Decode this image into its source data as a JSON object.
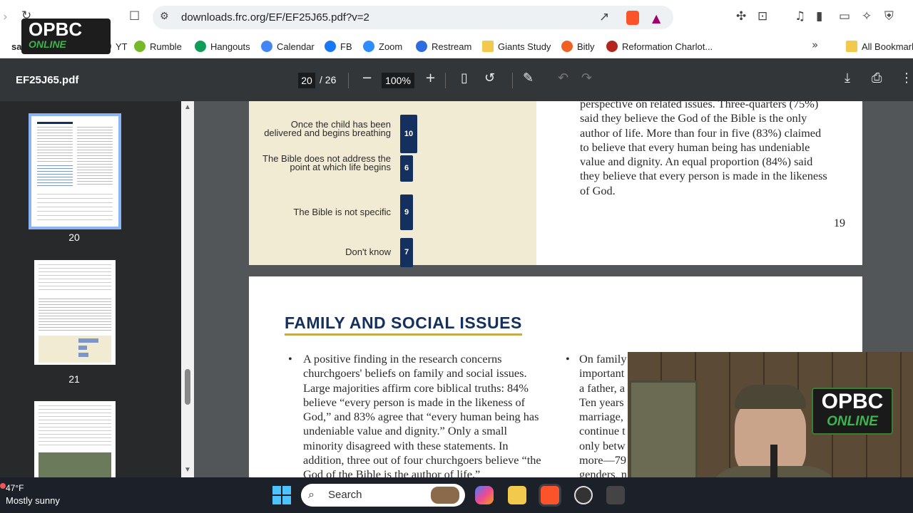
{
  "browser": {
    "url": "downloads.frc.org/EF/EF25J65.pdf?v=2",
    "overlay_logo_top": "OPBC",
    "overlay_logo_bottom": "ONLINE"
  },
  "bookmarks": [
    {
      "label": "YT",
      "icon": "youtube-icon",
      "color": "#e11"
    },
    {
      "label": "Rumble",
      "icon": "rumble-icon",
      "color": "#76b82a"
    },
    {
      "label": "Hangouts",
      "icon": "hangouts-icon",
      "color": "#0f9d58"
    },
    {
      "label": "Calendar",
      "icon": "calendar-icon",
      "color": "#4285f4"
    },
    {
      "label": "FB",
      "icon": "facebook-icon",
      "color": "#1877f2"
    },
    {
      "label": "Zoom",
      "icon": "zoom-icon",
      "color": "#2d8cff"
    },
    {
      "label": "Restream",
      "icon": "restream-icon",
      "color": "#2d6cdf"
    },
    {
      "label": "Giants Study",
      "icon": "folder-icon",
      "color": "#f2c94c"
    },
    {
      "label": "Bitly",
      "icon": "bitly-icon",
      "color": "#ee6123"
    },
    {
      "label": "Reformation Charlot...",
      "icon": "reformation-icon",
      "color": "#b3261e"
    },
    {
      "label": "All Bookmarks",
      "icon": "folder-icon",
      "color": "#f2c94c"
    }
  ],
  "pdf": {
    "filename": "EF25J65.pdf",
    "current_page": "20",
    "total_pages": "/ 26",
    "zoom": "100%",
    "thumbnails": [
      {
        "num": "20"
      },
      {
        "num": "21"
      }
    ]
  },
  "page19": {
    "bars": [
      {
        "label": "Once the child has been delivered and begins breathing",
        "value": 10
      },
      {
        "label": "The Bible does not address the point at which life begins",
        "value": 6
      },
      {
        "label": "The Bible is not specific",
        "value": 9
      },
      {
        "label": "Don't know",
        "value": 7
      }
    ],
    "text": "perspective on related issues. Three-quarters (75%) said they believe the God of the Bible is the only author of life. More than four in five (83%) claimed to believe that every human being has undeniable value and dignity. An equal proportion (84%) said they believe that every person is made in the likeness of God.",
    "page_number": "19"
  },
  "page20": {
    "section_title": "FAMILY AND SOCIAL ISSUES",
    "left_bullet": "A positive finding in the research concerns churchgoers' beliefs on family and social issues. Large majorities affirm core biblical truths: 84% believe “every person is made in the likeness of God,” and 83% agree that “every human being has undeniable value and dignity.” Only a small minority disagreed with these statements. In addition, three out of four churchgoers believe “the God of the Bible is the author of life.”",
    "right_lines": [
      "On family",
      "important",
      "a father, a",
      "Ten years",
      "marriage,",
      "continue t",
      "only betw",
      "more—79",
      "genders, n"
    ]
  },
  "webcam": {
    "logo_top": "OPBC",
    "logo_bottom": "ONLINE"
  },
  "taskbar": {
    "weather_temp": "47°F",
    "weather_desc": "Mostly sunny",
    "search_label": "Search"
  }
}
